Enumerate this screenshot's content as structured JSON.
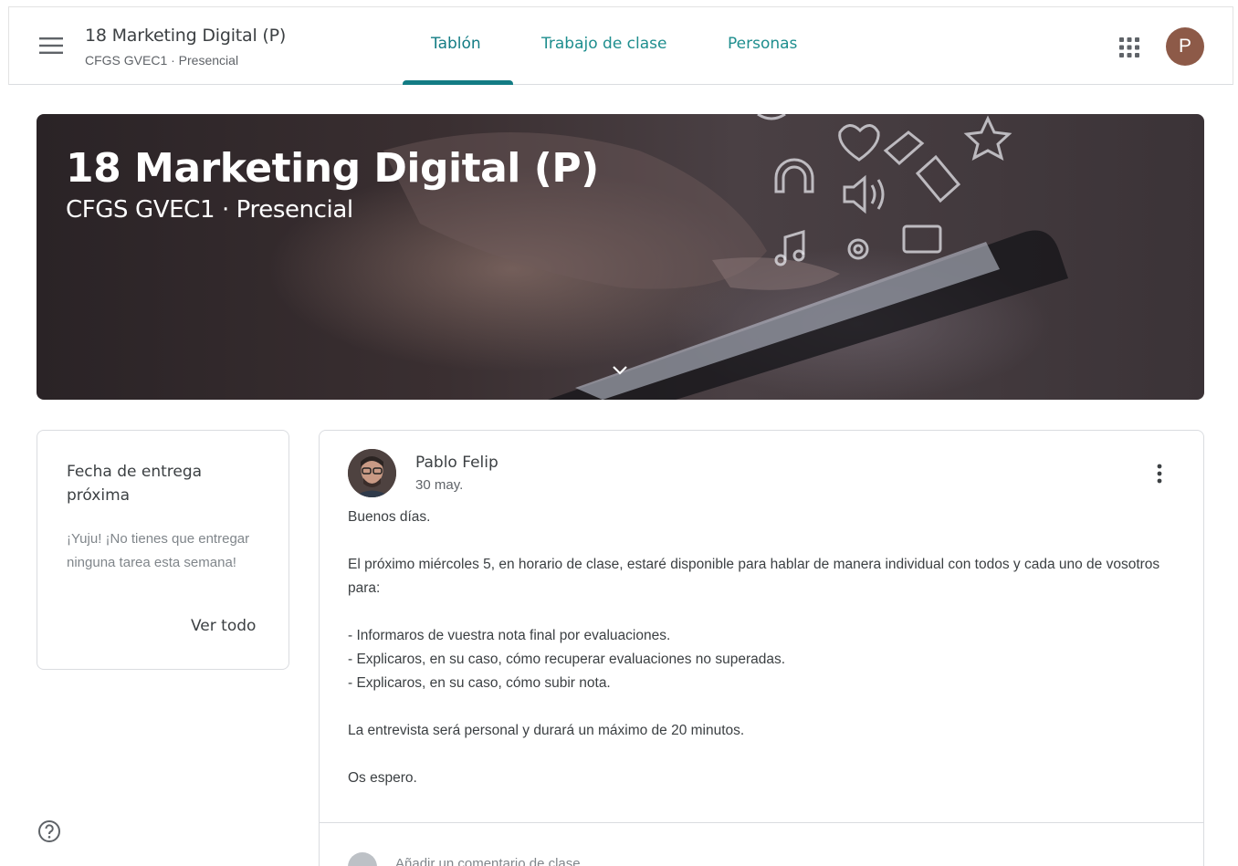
{
  "header": {
    "class_name": "18 Marketing Digital (P)",
    "class_section": "CFGS GVEC1 · Presencial",
    "tabs": [
      {
        "label": "Tablón",
        "active": true
      },
      {
        "label": "Trabajo de clase",
        "active": false
      },
      {
        "label": "Personas",
        "active": false
      }
    ],
    "account_initial": "P",
    "icons": {
      "menu": "hamburger-menu-icon",
      "apps": "google-apps-grid-icon"
    }
  },
  "banner": {
    "title": "18 Marketing Digital (P)",
    "subtitle": "CFGS GVEC1 · Presencial",
    "expand_icon": "chevron-down-icon"
  },
  "upcoming": {
    "title": "Fecha de entrega próxima",
    "message": "¡Yuju! ¡No tienes que entregar ninguna tarea esta semana!",
    "view_all": "Ver todo"
  },
  "post": {
    "author": "Pablo Felip",
    "date": "30 may.",
    "more_icon": "more-vert-icon",
    "body": [
      "Buenos días.",
      "",
      "El próximo miércoles 5, en horario de clase, estaré disponible para hablar de manera individual con todos y cada uno de vosotros para:",
      "",
      "- Informaros de vuestra nota final por evaluaciones.",
      "- Explicaros, en su caso, cómo recuperar evaluaciones no superadas.",
      "- Explicaros, en su caso, cómo subir nota.",
      "",
      "La entrevista será personal y durará un máximo de 20 minutos.",
      "",
      "Os espero."
    ],
    "comment_placeholder": "Añadir un comentario de clase"
  },
  "help": {
    "icon": "help-circle-icon"
  },
  "colors": {
    "accent": "#137c84",
    "tab_text": "#1e8e8e",
    "account_avatar": "#8d5a48"
  }
}
